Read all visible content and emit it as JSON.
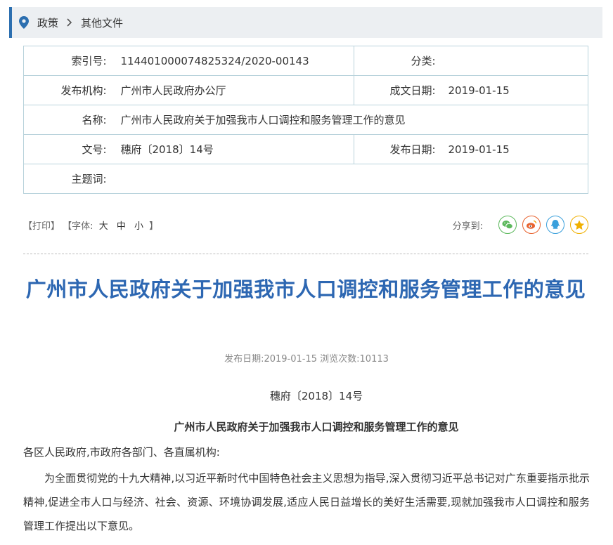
{
  "breadcrumb": {
    "items": [
      "政策",
      "其他文件"
    ]
  },
  "meta": {
    "index_label": "索引号:",
    "index_value": "114401000074825324/2020-00143",
    "category_label": "分类:",
    "category_value": "",
    "issuer_label": "发布机构:",
    "issuer_value": "广州市人民政府办公厅",
    "written_date_label": "成文日期:",
    "written_date_value": "2019-01-15",
    "name_label": "名称:",
    "name_value": "广州市人民政府关于加强我市人口调控和服务管理工作的意见",
    "docno_label": "文号:",
    "docno_value": "穗府〔2018〕14号",
    "publish_date_label": "发布日期:",
    "publish_date_value": "2019-01-15",
    "subject_label": "主题词:",
    "subject_value": ""
  },
  "tools": {
    "print": "【打印】",
    "font_prefix": "【字体:",
    "font_large": "大",
    "font_medium": "中",
    "font_small": "小",
    "font_suffix": "】",
    "share_label": "分享到:"
  },
  "share": {
    "wechat_color": "#5cb85c",
    "weibo_color": "#e8622e",
    "qq_color": "#3aa0dc",
    "qzone_color": "#f0b000"
  },
  "article": {
    "title": "广州市人民政府关于加强我市人口调控和服务管理工作的意见",
    "pubinfo": "发布日期:2019-01-15  浏览次数:10113",
    "docno": "穗府〔2018〕14号",
    "subtitle": "广州市人民政府关于加强我市人口调控和服务管理工作的意见",
    "salutation": "各区人民政府,市政府各部门、各直属机构:",
    "paragraph": "为全面贯彻党的十九大精神,以习近平新时代中国特色社会主义思想为指导,深入贯彻习近平总书记对广东重要指示批示精神,促进全市人口与经济、社会、资源、环境协调发展,适应人民日益增长的美好生活需要,现就加强我市人口调控和服务管理工作提出以下意见。"
  },
  "colors": {
    "accent": "#2d67b2",
    "border": "#b9d3dc"
  }
}
